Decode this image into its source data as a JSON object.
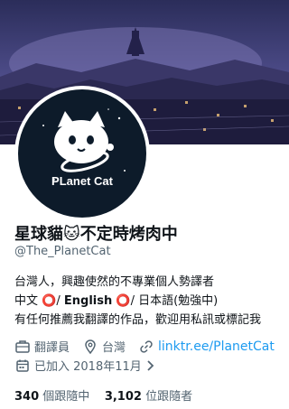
{
  "profile": {
    "display_name": "星球貓🐱不定時烤肉中",
    "handle": "@The_PlanetCat",
    "avatar_text": "PLanet Cat",
    "bio_line1": "台灣人，興趣使然的不專業個人勢譯者",
    "bio_line2_a": "中文",
    "bio_line2_b": "English",
    "bio_line2_c": "日本語(勉強中)",
    "bio_line3": "有任何推薦我翻譯的作品，歡迎用私訊或標記我",
    "ring_symbol": "⭕",
    "slash": "/",
    "occupation": "翻譯員",
    "location": "台灣",
    "website": "linktr.ee/PlanetCat",
    "joined": "已加入 2018年11月",
    "following_count": "340",
    "following_label": "個跟隨中",
    "followers_count": "3,102",
    "followers_label": "位跟隨者"
  },
  "colors": {
    "link": "#1d9bf0",
    "muted": "#536471",
    "ring": "#e0245e"
  },
  "icons": {
    "occupation": "briefcase-icon",
    "location": "location-pin-icon",
    "website": "link-icon",
    "joined": "calendar-icon",
    "more": "chevron-right-icon"
  }
}
